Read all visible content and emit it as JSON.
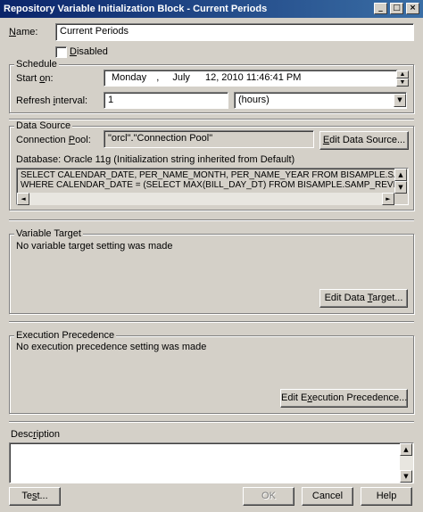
{
  "window": {
    "title": "Repository Variable Initialization Block - Current Periods",
    "min_glyph": "_",
    "max_glyph": "□",
    "close_glyph": "×"
  },
  "name": {
    "label_pre": "",
    "label_u": "N",
    "label_post": "ame:",
    "value": "Current Periods"
  },
  "disabled": {
    "label_u": "D",
    "label_post": "isabled",
    "checked": false
  },
  "schedule": {
    "group_label": "Schedule",
    "start_label_pre": "Start ",
    "start_label_u": "o",
    "start_label_post": "n:",
    "start_day": "Monday",
    "start_sep": ",",
    "start_month": "July",
    "start_rest": "12, 2010 11:46:41 PM",
    "refresh_label_pre": "Refresh ",
    "refresh_label_u": "i",
    "refresh_label_post": "nterval:",
    "refresh_value": "1",
    "refresh_unit": "(hours)"
  },
  "data_source": {
    "group_label": "Data Source",
    "pool_label_pre": "Connection ",
    "pool_label_u": "P",
    "pool_label_post": "ool:",
    "pool_value": "\"orcl\".\"Connection Pool\"",
    "edit_btn_pre": "",
    "edit_btn_u": "E",
    "edit_btn_post": "dit Data Source...",
    "database_text": "Database: Oracle 11g (Initialization string inherited from Default)",
    "sql_line1": "SELECT CALENDAR_DATE, PER_NAME_MONTH, PER_NAME_YEAR FROM BISAMPLE.SAMP_TIME_DAY_D",
    "sql_line2": "WHERE CALENDAR_DATE = (SELECT MAX(BILL_DAY_DT) FROM BISAMPLE.SAMP_REVENUE_F)"
  },
  "variable_target": {
    "group_label": "Variable Target",
    "message": "No variable target setting was made",
    "edit_btn_pre": "Edit Data ",
    "edit_btn_u": "T",
    "edit_btn_post": "arget..."
  },
  "execution_precedence": {
    "group_label": "Execution Precedence",
    "message": "No execution precedence setting was made",
    "edit_btn_pre": "Edit E",
    "edit_btn_u": "x",
    "edit_btn_post": "ecution Precedence..."
  },
  "description": {
    "label_pre": "Desc",
    "label_u": "r",
    "label_post": "iption",
    "value": ""
  },
  "footer": {
    "test_pre": "Te",
    "test_u": "s",
    "test_post": "t...",
    "ok": "OK",
    "cancel": "Cancel",
    "help": "Help"
  },
  "icons": {
    "up": "▲",
    "down": "▼",
    "left": "◄",
    "right": "►"
  }
}
